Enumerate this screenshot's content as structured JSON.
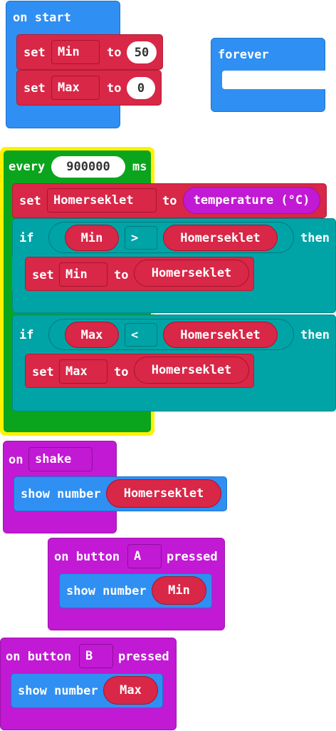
{
  "on_start": {
    "label": "on start",
    "set1": {
      "set": "set",
      "var": "Min",
      "to": "to",
      "value": "50"
    },
    "set2": {
      "set": "set",
      "var": "Max",
      "to": "to",
      "value": "0"
    }
  },
  "forever": {
    "label": "forever"
  },
  "every": {
    "label": "every",
    "value": "900000",
    "unit": "ms",
    "set_temp": {
      "set": "set",
      "var": "Homerseklet",
      "to": "to",
      "value": "temperature (°C)"
    },
    "if1": {
      "if": "if",
      "left": "Min",
      "op": ">",
      "right": "Homerseklet",
      "then": "then",
      "body": {
        "set": "set",
        "var": "Min",
        "to": "to",
        "value": "Homerseklet"
      }
    },
    "if2": {
      "if": "if",
      "left": "Max",
      "op": "<",
      "right": "Homerseklet",
      "then": "then",
      "body": {
        "set": "set",
        "var": "Max",
        "to": "to",
        "value": "Homerseklet"
      }
    }
  },
  "on_shake": {
    "on": "on",
    "event": "shake",
    "show": "show number",
    "value": "Homerseklet"
  },
  "button_a": {
    "on": "on button",
    "button": "A",
    "pressed": "pressed",
    "show": "show number",
    "value": "Min"
  },
  "button_b": {
    "on": "on button",
    "button": "B",
    "pressed": "pressed",
    "show": "show number",
    "value": "Max"
  },
  "colors": {
    "blue": "#2f8ff2",
    "red": "#d82747",
    "teal": "#00a4a6",
    "magenta": "#c219d4",
    "green": "#0aa51c",
    "highlight": "#fff200"
  }
}
